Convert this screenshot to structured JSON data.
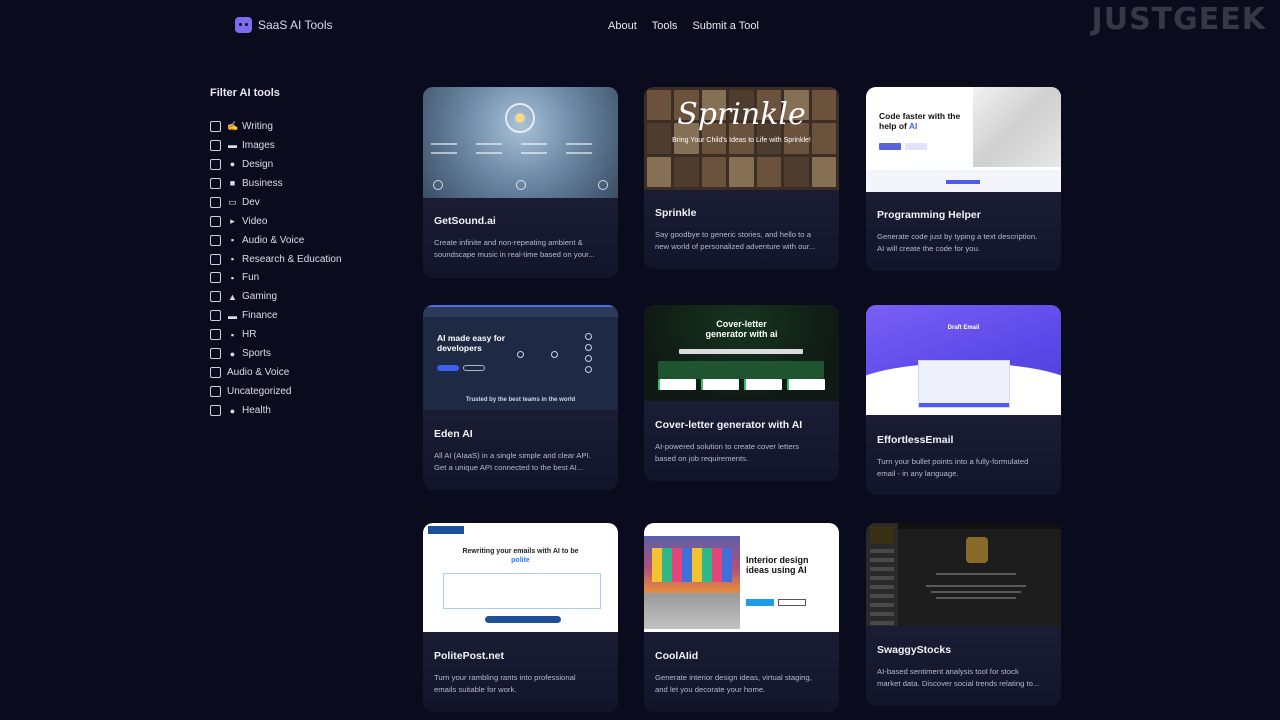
{
  "header": {
    "logo_text": "SaaS AI Tools",
    "nav": [
      "About",
      "Tools",
      "Submit a Tool"
    ],
    "watermark": "JUSTGEEK"
  },
  "sidebar": {
    "title": "Filter AI tools",
    "filters": [
      {
        "label": "Writing",
        "icon": "✍"
      },
      {
        "label": "Images",
        "icon": "▬"
      },
      {
        "label": "Design",
        "icon": "●"
      },
      {
        "label": "Business",
        "icon": "■"
      },
      {
        "label": "Dev",
        "icon": "▭"
      },
      {
        "label": "Video",
        "icon": "▸"
      },
      {
        "label": "Audio & Voice",
        "icon": "▪"
      },
      {
        "label": "Research & Education",
        "icon": "▪"
      },
      {
        "label": "Fun",
        "icon": "▪"
      },
      {
        "label": "Gaming",
        "icon": "▲"
      },
      {
        "label": "Finance",
        "icon": "▬"
      },
      {
        "label": "HR",
        "icon": "▪"
      },
      {
        "label": "Sports",
        "icon": "●"
      },
      {
        "label": "Audio & Voice",
        "icon": ""
      },
      {
        "label": "Uncategorized",
        "icon": ""
      },
      {
        "label": "Health",
        "icon": "●"
      }
    ]
  },
  "tools": [
    {
      "name": "GetSound.ai",
      "desc_1": "Create infinite and non-repeating ambient &",
      "desc_2": "soundscape music in real-time based on your..."
    },
    {
      "name": "Sprinkle",
      "desc_1": "Say goodbye to generic stories, and hello to a",
      "desc_2": "new world of personalized adventure with our...",
      "thumb_title": "Sprinkle",
      "thumb_sub": "Bring Your Child's Ideas to Life with Sprinkle!"
    },
    {
      "name": "Programming Helper",
      "desc_1": "Generate code just by typing a text description.",
      "desc_2": "AI will create the code for you.",
      "thumb_head": "Code faster with the help of",
      "thumb_head_accent": "AI"
    },
    {
      "name": "Eden AI",
      "desc_1": "All AI (AIaaS) in a single simple and clear API.",
      "desc_2": "Get a unique API connected to the best AI...",
      "thumb_head": "AI made easy for developers",
      "thumb_foot": "Trusted by the best teams in the world"
    },
    {
      "name": "Cover-letter generator with AI",
      "desc_1": "AI-powered solution to create cover letters",
      "desc_2": "based on job requirements.",
      "thumb_head": "Cover-letter generator with ai"
    },
    {
      "name": "EffortlessEmail",
      "desc_1": "Turn your bullet points into a fully-formulated",
      "desc_2": "email - in any language.",
      "thumb_head": "Draft Email"
    },
    {
      "name": "PolitePost.net",
      "desc_1": "Turn your rambling rants into professional",
      "desc_2": "emails suitable for work.",
      "thumb_head": "Rewriting your emails with AI to be",
      "thumb_head_accent": "polite"
    },
    {
      "name": "CoolAIid",
      "desc_1": "Generate interior design ideas, virtual staging,",
      "desc_2": "and let you decorate your home.",
      "thumb_head": "Interior design ideas using AI"
    },
    {
      "name": "SwaggyStocks",
      "desc_1": "AI-based sentiment analysis tool for stock",
      "desc_2": "market data. Discover social trends relating to..."
    }
  ]
}
